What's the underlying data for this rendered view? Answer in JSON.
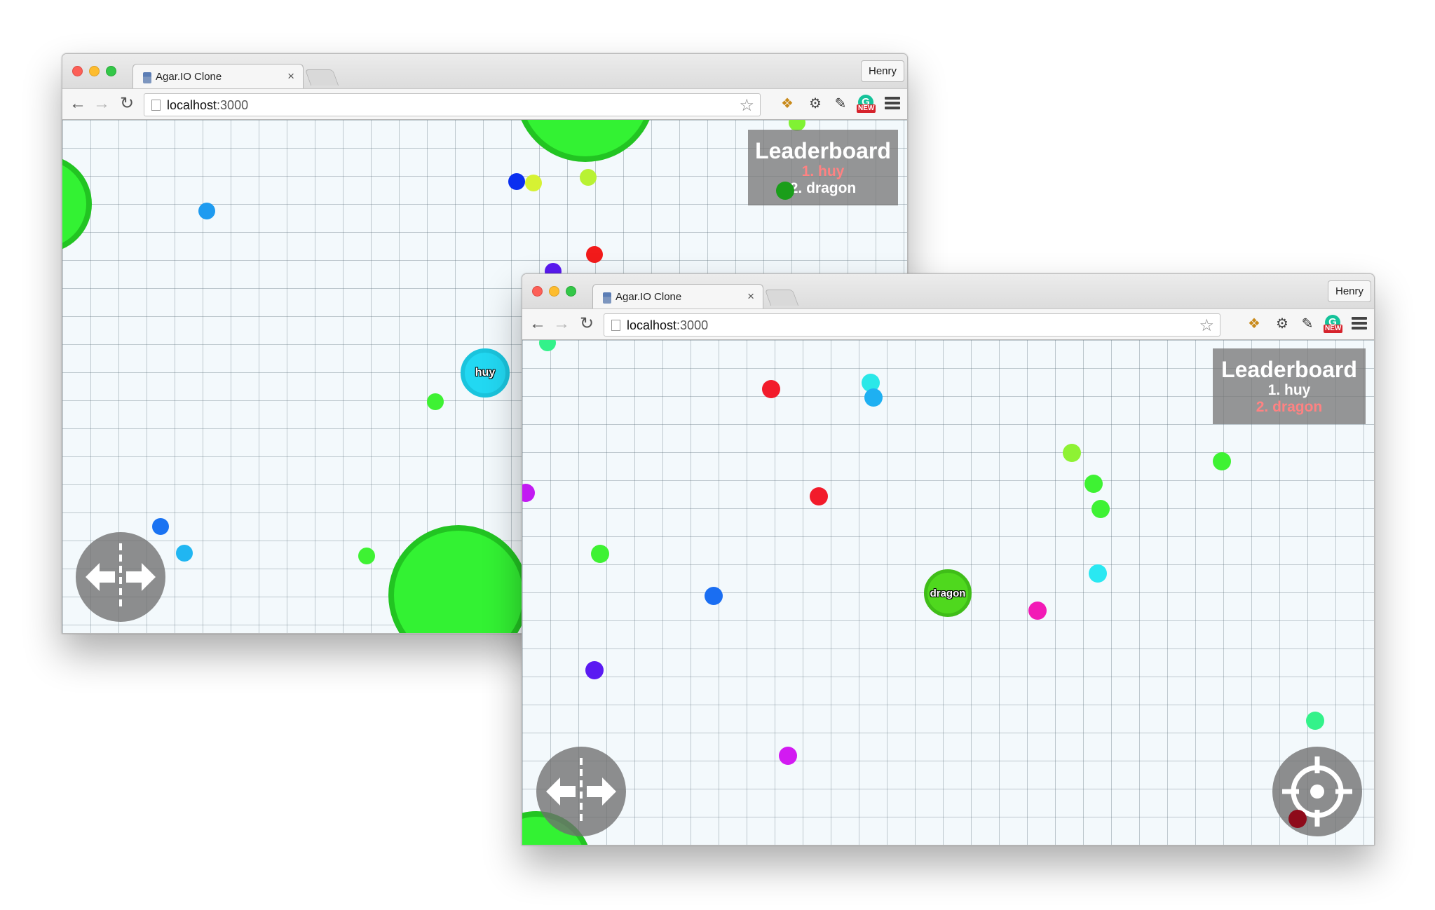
{
  "windows": [
    {
      "tab_title": "Agar.IO Clone",
      "tab_close": "×",
      "profile": "Henry",
      "url_host": "localhost",
      "url_port": ":3000",
      "leaderboard": {
        "title": "Leaderboard",
        "entries": [
          "1. huy",
          "2. dragon"
        ],
        "highlighted_index": 0
      },
      "player_cell": {
        "name": "huy",
        "color": "#22d8f2"
      }
    },
    {
      "tab_title": "Agar.IO Clone",
      "tab_close": "×",
      "profile": "Henry",
      "url_host": "localhost",
      "url_port": ":3000",
      "leaderboard": {
        "title": "Leaderboard",
        "entries": [
          "1. huy",
          "2. dragon"
        ],
        "highlighted_index": 1
      },
      "player_cell": {
        "name": "dragon",
        "color": "#4fd81e"
      }
    }
  ],
  "icons": {
    "back": "arrow-left-icon",
    "forward": "arrow-right-icon",
    "reload": "reload-icon",
    "bookmark": "star-icon",
    "menu": "hamburger-menu-icon",
    "split": "split-arrows-icon",
    "target": "crosshair-icon"
  },
  "extensions": {
    "grammarly_badge": "NEW"
  },
  "colors": {
    "big_cell_green": "#33f233",
    "big_cell_border": "#22c422",
    "grid_bg": "#f3f9fc",
    "leaderboard_highlight": "#ff8282"
  }
}
